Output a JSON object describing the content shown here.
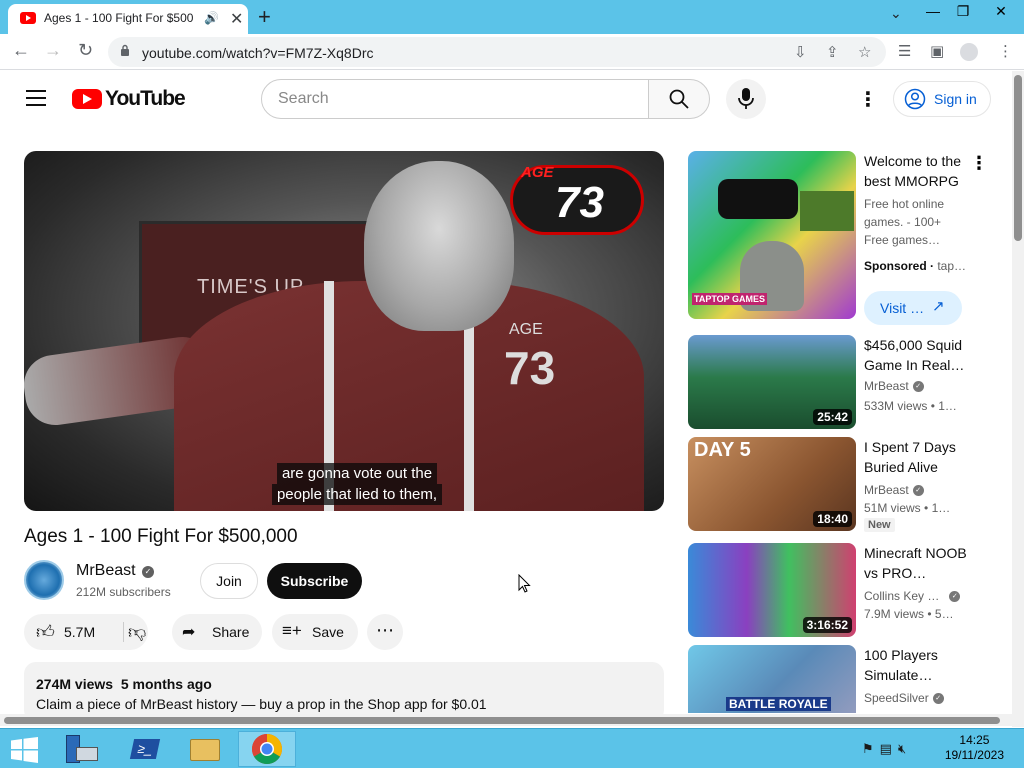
{
  "browser": {
    "tab_title": "Ages 1 - 100 Fight For $500,000",
    "tab_title_short": "Ages 1 - 100 Fight For $500",
    "url": "youtube.com/watch?v=FM7Z-Xq8Drc"
  },
  "youtube": {
    "logo_text": "YouTube",
    "search_placeholder": "Search",
    "signin_label": "Sign in"
  },
  "video": {
    "age_badge_label": "AGE",
    "age_badge_number": "73",
    "screen_text": "TIME'S UP",
    "jacket_label": "AGE",
    "jacket_number": "73",
    "caption_line1": "are gonna vote out the",
    "caption_line2": "people that lied to them,",
    "title": "Ages 1 - 100 Fight For $500,000",
    "channel": "MrBeast",
    "subscribers": "212M subscribers",
    "join_label": "Join",
    "subscribe_label": "Subscribe",
    "likes": "5.7M",
    "share_label": "Share",
    "save_label": "Save",
    "views": "274M views",
    "age": "5 months ago",
    "description": "Claim a piece of MrBeast history — buy a prop in the Shop app for $0.01"
  },
  "sidebar": {
    "ad": {
      "title": "Welcome to the best MMORPG",
      "description": "Free hot online games. - 100+ Free games…",
      "sponsored": "Sponsored",
      "advertiser": "tap…",
      "visit_label": "Visit …",
      "thumb_text": "TAPTOP GAMES"
    },
    "items": [
      {
        "title": "$456,000 Squid Game In Real…",
        "channel": "MrBeast",
        "views": "533M views",
        "age": "1…",
        "duration": "25:42"
      },
      {
        "title": "I Spent 7 Days Buried Alive",
        "channel": "MrBeast",
        "views": "51M views",
        "age": "1…",
        "duration": "18:40",
        "badge": "New",
        "thumb_text": "DAY 5"
      },
      {
        "title": "Minecraft NOOB vs PRO…",
        "channel": "Collins Key …",
        "views": "7.9M views",
        "age": "5…",
        "duration": "3:16:52"
      },
      {
        "title": "100 Players Simulate…",
        "channel": "SpeedSilver",
        "thumb_text": "BATTLE ROYALE"
      }
    ]
  },
  "taskbar": {
    "time": "14:25",
    "date": "19/11/2023"
  }
}
